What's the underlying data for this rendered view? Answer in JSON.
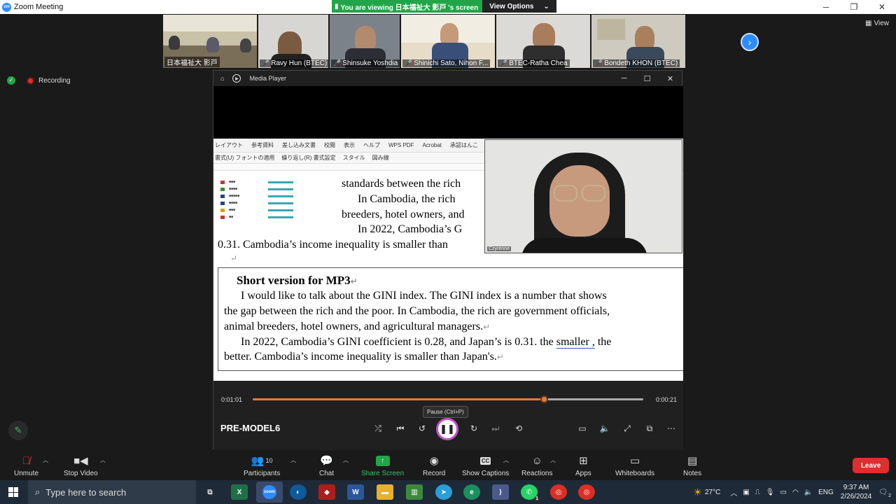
{
  "window": {
    "title": "Zoom Meeting",
    "icon_text": "zm"
  },
  "banner": {
    "viewing_text": "You are viewing 日本福祉大 影戸 's screen",
    "view_options": "View Options",
    "colors": {
      "green": "#22a548",
      "dark": "#232323"
    }
  },
  "gallery": {
    "participants": [
      {
        "name": "日本福祉大 影戸",
        "muted": false
      },
      {
        "name": "Ravy Hun (BTEC)",
        "muted": true
      },
      {
        "name": "Shinsuke Yoshdia",
        "muted": true
      },
      {
        "name": "Shinichi Sato, Nihon F...",
        "muted": true
      },
      {
        "name": "BTEC-Ratha Chea",
        "muted": true
      },
      {
        "name": "Bondeth KHON (BTEC)",
        "muted": true
      }
    ],
    "view_label": "View"
  },
  "status": {
    "recording": "Recording"
  },
  "media_player": {
    "title": "Media Player",
    "ribbon_tabs": [
      "レイアウト",
      "参考資料",
      "差し込み文書",
      "校閲",
      "表示",
      "ヘルプ",
      "WPS PDF",
      "Acrobat",
      "承認はんこ"
    ],
    "ribbon2_items": [
      "書式(U) フォントの適用",
      "繰り返し(R) 書式設定",
      "スタイル",
      "図み線"
    ],
    "doc_lines": [
      "standards between the rich",
      "In Cambodia, the rich",
      "breeders, hotel owners, and",
      "In 2022, Cambodia’s G",
      "0.31. Cambodia’s income inequality is smaller than"
    ],
    "short_heading": "Short version for MP3",
    "short_lines": [
      "I would like to talk about the GINI index. The GINI index is a number that shows",
      "the gap between the rich and the poor. In Cambodia, the rich are government officials,",
      "animal breeders, hotel owners, and agricultural managers.",
      "In 2022, Cambodia’s GINI coefficient is 0.28, and Japan’s is 0.31. the",
      "smaller ,",
      " the",
      "better. Cambodia’s income inequality is smaller than Japan's."
    ],
    "cam_label": "Czyrenne",
    "time_elapsed": "0:01:01",
    "time_remaining": "0:00:21",
    "progress_fraction": 0.745,
    "track_name": "PRE-MODEL6",
    "tooltip": "Pause (Ctrl+P)",
    "accent": "#ea7a36"
  },
  "toolbar": {
    "unmute": "Unmute",
    "stop_video": "Stop Video",
    "participants": "Participants",
    "participants_count": "10",
    "chat": "Chat",
    "share_screen": "Share Screen",
    "record": "Record",
    "show_captions": "Show Captions",
    "reactions": "Reactions",
    "apps": "Apps",
    "whiteboards": "Whiteboards",
    "notes": "Notes",
    "leave": "Leave",
    "cc": "CC",
    "share_color": "#22a548",
    "leave_color": "#e02d2d"
  },
  "taskbar": {
    "search_placeholder": "Type here to search",
    "weather": "27°C",
    "lang": "ENG",
    "time": "9:37 AM",
    "date": "2/26/2024",
    "notif_count": "2",
    "whatsapp_badge": "1"
  }
}
